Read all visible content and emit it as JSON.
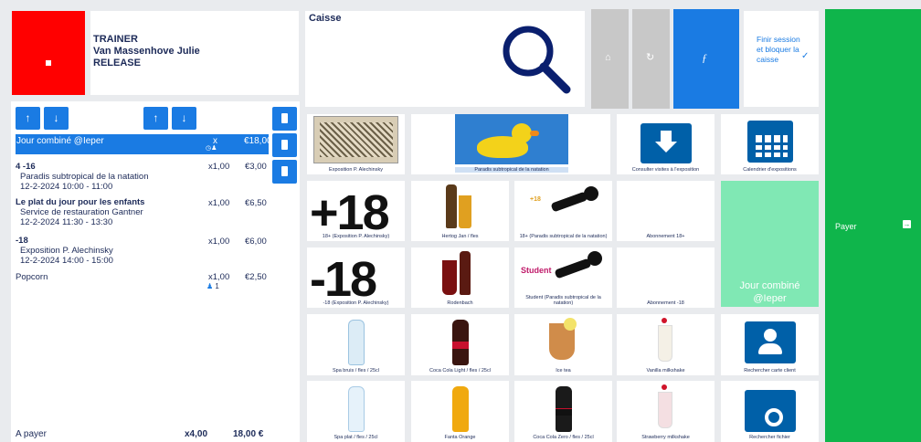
{
  "header": {
    "role": "TRAINER",
    "user_name": "Van Massenhove Julie",
    "release": "RELEASE"
  },
  "caisse": {
    "title": "Caisse"
  },
  "finir": {
    "label": "Finir session et bloquer la caisse"
  },
  "pay": {
    "label": "Payer"
  },
  "order": {
    "selected": {
      "name": "Jour combiné @Ieper",
      "qty": "x",
      "price": "€18,00"
    },
    "lines": [
      {
        "name": "4 -16",
        "sub": "Paradis subtropical de la natation",
        "time": "12-2-2024 10:00 - 11:00",
        "qty": "x1,00",
        "price": "€3,00"
      },
      {
        "name": "Le plat du jour pour les enfants",
        "sub": "Service de restauration Gantner",
        "time": "12-2-2024 11:30 - 13:30",
        "qty": "x1,00",
        "price": "€6,50"
      },
      {
        "name": "-18",
        "sub": "Exposition P. Alechinsky",
        "time": "12-2-2024 14:00 - 15:00",
        "qty": "x1,00",
        "price": "€6,00"
      },
      {
        "name": "Popcorn",
        "sub": "",
        "time": "",
        "qty": "x1,00",
        "price": "€2,50",
        "persons": "1"
      }
    ],
    "total_label": "A payer",
    "total_qty": "x4,00",
    "total_price": "18,00 €"
  },
  "tiles": [
    {
      "label": "Exposition P. Alechinsky"
    },
    {
      "label": "Paradis subtropical de la natation"
    },
    {
      "label": "Consulter visites à l'exposition"
    },
    {
      "label": "Calendrier d'expositions"
    },
    {
      "label": "18+ (Exposition P. Alechinsky)",
      "big": "+18"
    },
    {
      "label": "Hertog Jan / fles"
    },
    {
      "label": "18+ (Paradis subtropical de la natation)",
      "mini": "+18"
    },
    {
      "label": "Abonnement 18+"
    },
    {
      "label": "Jour combiné @Ieper"
    },
    {
      "label": "-18 (Exposition P. Alechinsky)",
      "big": "-18"
    },
    {
      "label": "Rodenbach"
    },
    {
      "label": "Student (Paradis subtropical de la natation)",
      "mini": "Student"
    },
    {
      "label": "Abonnement -18"
    },
    {
      "label": "Spa bruis / fles / 25cl"
    },
    {
      "label": "Coca Cola Light / fles / 25cl"
    },
    {
      "label": "Ice tea"
    },
    {
      "label": "Vanilla milkshake"
    },
    {
      "label": "Rechercher carte client"
    },
    {
      "label": "Spa plat / fles / 25cl"
    },
    {
      "label": "Fanta Orange"
    },
    {
      "label": "Coca Cola Zero / fles / 25cl"
    },
    {
      "label": "Strawberry milkshake"
    },
    {
      "label": "Rechercher fichier"
    }
  ],
  "colors": {
    "accent": "#1a7be3",
    "pay": "#0fb54b",
    "combo": "#80e8b4",
    "red": "#ff0000"
  }
}
